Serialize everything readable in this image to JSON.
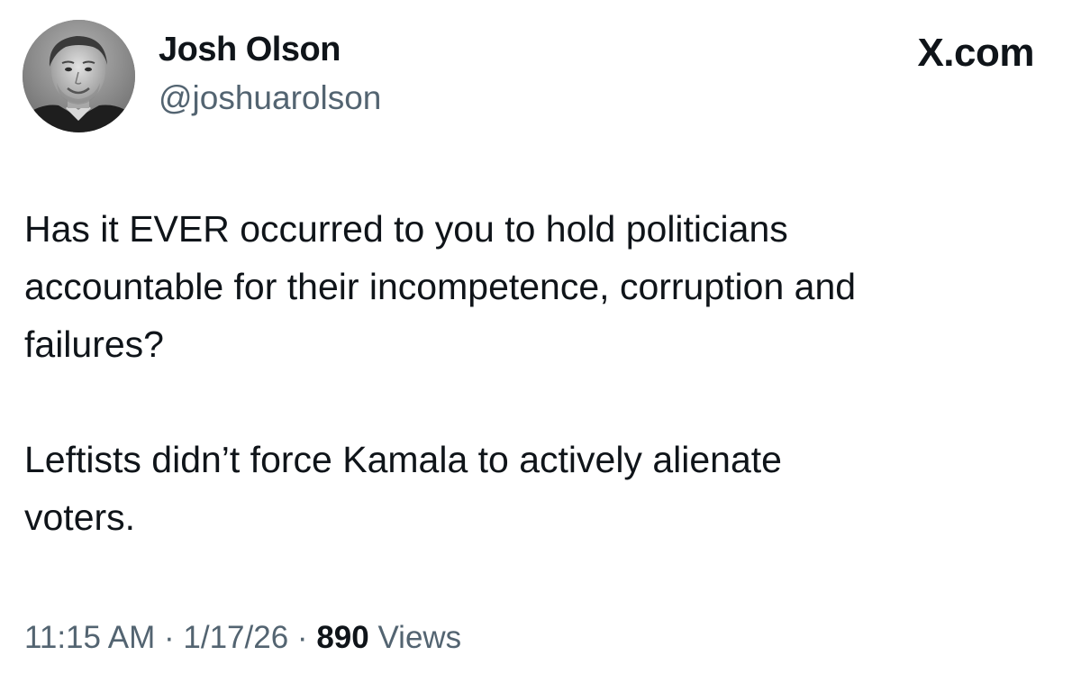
{
  "author": {
    "name": "Josh Olson",
    "handle": "@joshuarolson"
  },
  "brand": "X.com",
  "post": {
    "paragraphs": [
      "Has it EVER occurred to you to hold politicians\naccountable for their incompetence, corruption and\nfailures?",
      "Leftists didn’t force Kamala to actively alienate\nvoters."
    ]
  },
  "meta": {
    "time": "11:15 AM",
    "separator": "·",
    "date": "1/17/26",
    "views_count": "890",
    "views_label": "Views"
  },
  "colors": {
    "text_primary": "#0f1419",
    "text_secondary": "#536471",
    "background": "#ffffff"
  },
  "icons": {
    "avatar": "profile-photo"
  }
}
